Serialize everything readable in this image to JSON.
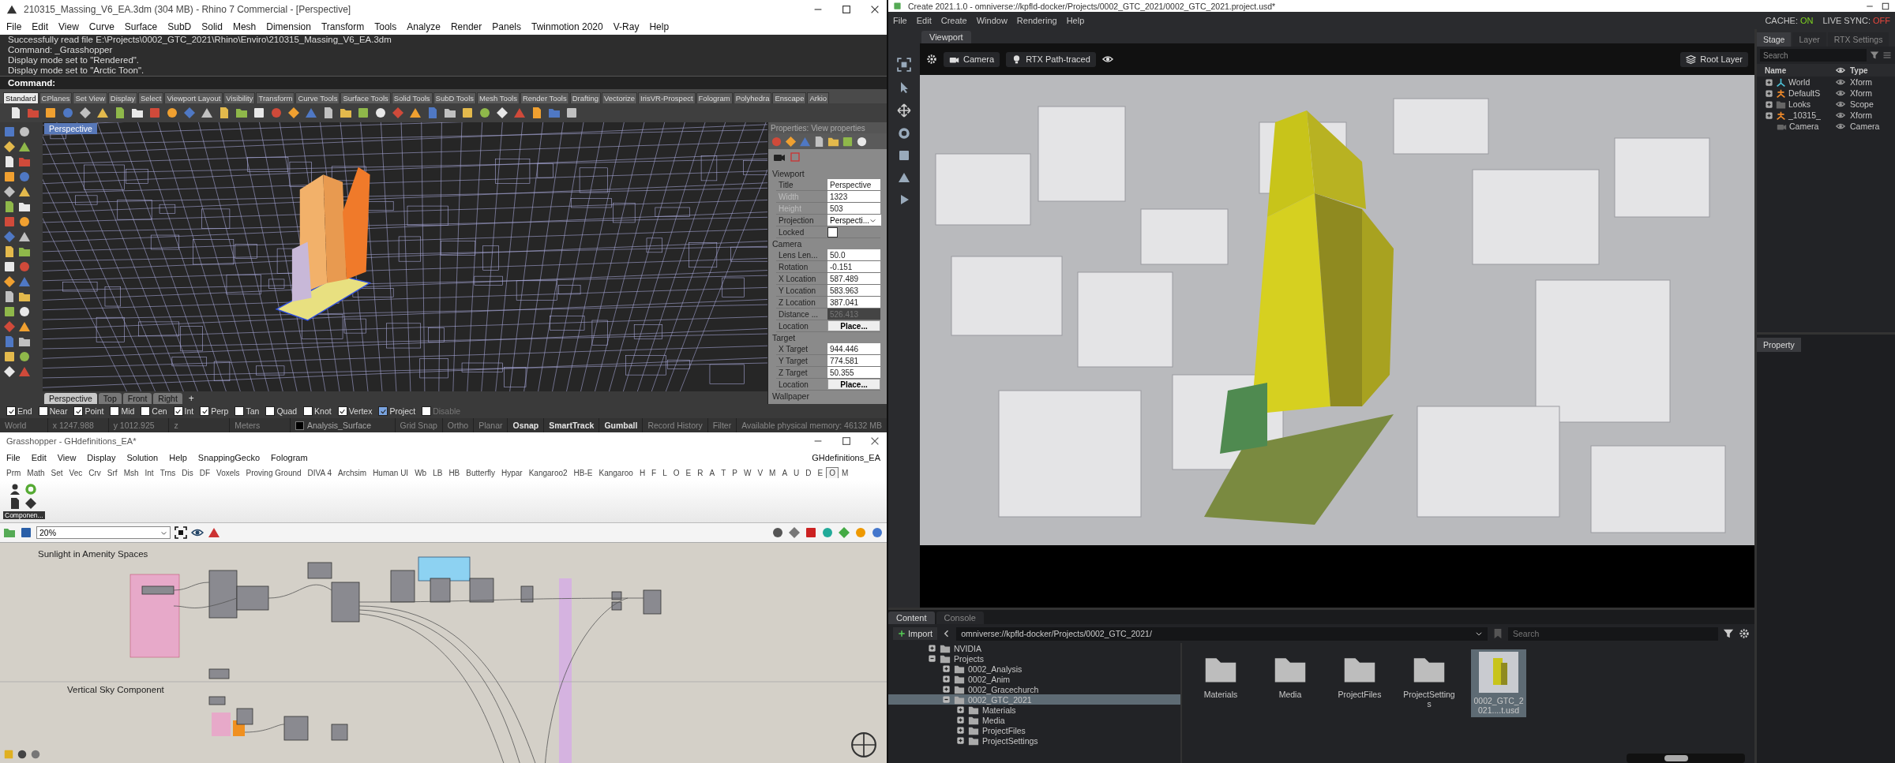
{
  "rhino": {
    "title": "210315_Massing_V6_EA.3dm (304 MB) - Rhino 7 Commercial - [Perspective]",
    "menu": [
      "File",
      "Edit",
      "View",
      "Curve",
      "Surface",
      "SubD",
      "Solid",
      "Mesh",
      "Dimension",
      "Transform",
      "Tools",
      "Analyze",
      "Render",
      "Panels",
      "Twinmotion 2020",
      "V-Ray",
      "Help"
    ],
    "command_history": [
      "Successfully read file  E:\\Projects\\0002_GTC_2021\\Rhino\\Enviro\\210315_Massing_V6_EA.3dm",
      "Command: _Grasshopper",
      "Display mode set to \"Rendered\".",
      "Display mode set to \"Arctic Toon\"."
    ],
    "command_prompt": "Command:",
    "toolbar_tabs": [
      {
        "label": "Standard",
        "selected": true
      },
      {
        "label": "CPlanes",
        "selected": false
      },
      {
        "label": "Set View",
        "selected": false
      },
      {
        "label": "Display",
        "selected": false
      },
      {
        "label": "Select",
        "selected": false
      },
      {
        "label": "Viewport Layout",
        "selected": false
      },
      {
        "label": "Visibility",
        "selected": false
      },
      {
        "label": "Transform",
        "selected": false
      },
      {
        "label": "Curve Tools",
        "selected": false
      },
      {
        "label": "Surface Tools",
        "selected": false
      },
      {
        "label": "Solid Tools",
        "selected": false
      },
      {
        "label": "SubD Tools",
        "selected": false
      },
      {
        "label": "Mesh Tools",
        "selected": false
      },
      {
        "label": "Render Tools",
        "selected": false
      },
      {
        "label": "Drafting",
        "selected": false
      },
      {
        "label": "Vectorize",
        "selected": false
      },
      {
        "label": "IrisVR-Prospect",
        "selected": false
      },
      {
        "label": "Fologram",
        "selected": false
      },
      {
        "label": "Polyhedra",
        "selected": false
      },
      {
        "label": "Enscape",
        "selected": false
      },
      {
        "label": "Arkio",
        "selected": false
      }
    ],
    "viewport": {
      "label": "Perspective"
    },
    "viewport_tabs": [
      {
        "label": "Perspective",
        "selected": true
      },
      {
        "label": "Top",
        "selected": false
      },
      {
        "label": "Front",
        "selected": false
      },
      {
        "label": "Right",
        "selected": false
      }
    ],
    "viewport_add": "+",
    "properties": {
      "title": "Properties: View properties",
      "sections": [
        {
          "heading": "Viewport",
          "rows": [
            {
              "kind": "text",
              "label": "Title",
              "value": "Perspective",
              "disabled": false,
              "read_only": false
            },
            {
              "kind": "text",
              "label": "Width",
              "value": "1323",
              "disabled": true,
              "read_only": false
            },
            {
              "kind": "text",
              "label": "Height",
              "value": "503",
              "disabled": true,
              "read_only": false
            },
            {
              "kind": "dropdown",
              "label": "Projection",
              "value": "Perspecti..."
            },
            {
              "kind": "checkbox",
              "label": "Locked",
              "checked": false
            }
          ]
        },
        {
          "heading": "Camera",
          "rows": [
            {
              "kind": "text",
              "label": "Lens Len...",
              "value": "50.0",
              "disabled": false,
              "read_only": false
            },
            {
              "kind": "text",
              "label": "Rotation",
              "value": "-0.151",
              "disabled": false,
              "read_only": false
            },
            {
              "kind": "text",
              "label": "X Location",
              "value": "587.489",
              "disabled": false,
              "read_only": false
            },
            {
              "kind": "text",
              "label": "Y Location",
              "value": "583.963",
              "disabled": false,
              "read_only": false
            },
            {
              "kind": "text",
              "label": "Z Location",
              "value": "387.041",
              "disabled": false,
              "read_only": false
            },
            {
              "kind": "text",
              "label": "Distance ...",
              "value": "526.413",
              "disabled": false,
              "read_only": true
            },
            {
              "kind": "button",
              "label": "Location",
              "value": "Place..."
            }
          ]
        },
        {
          "heading": "Target",
          "rows": [
            {
              "kind": "text",
              "label": "X Target",
              "value": "944.446",
              "disabled": false,
              "read_only": false
            },
            {
              "kind": "text",
              "label": "Y Target",
              "value": "774.581",
              "disabled": false,
              "read_only": false
            },
            {
              "kind": "text",
              "label": "Z Target",
              "value": "50.355",
              "disabled": false,
              "read_only": false
            },
            {
              "kind": "button",
              "label": "Location",
              "value": "Place..."
            }
          ]
        },
        {
          "heading": "Wallpaper"
        }
      ]
    },
    "osnaps": [
      {
        "label": "End",
        "checked": true,
        "disabled": false
      },
      {
        "label": "Near",
        "checked": false,
        "disabled": false
      },
      {
        "label": "Point",
        "checked": true,
        "disabled": false
      },
      {
        "label": "Mid",
        "checked": false,
        "disabled": false
      },
      {
        "label": "Cen",
        "checked": false,
        "disabled": false
      },
      {
        "label": "Int",
        "checked": true,
        "disabled": false
      },
      {
        "label": "Perp",
        "checked": true,
        "disabled": false
      },
      {
        "label": "Tan",
        "checked": false,
        "disabled": false
      },
      {
        "label": "Quad",
        "checked": false,
        "disabled": false
      },
      {
        "label": "Knot",
        "checked": false,
        "disabled": false
      },
      {
        "label": "Vertex",
        "checked": true,
        "disabled": false
      },
      {
        "label": "Project",
        "checked": true,
        "disabled": false
      },
      {
        "label": "Disable",
        "checked": false,
        "disabled": true
      }
    ],
    "status_bar": [
      {
        "kind": "pane",
        "label": "World"
      },
      {
        "kind": "pane",
        "label": "x 1247.988"
      },
      {
        "kind": "pane",
        "label": "y 1012.925"
      },
      {
        "kind": "pane",
        "label": "z"
      },
      {
        "kind": "pane",
        "label": "Meters"
      },
      {
        "kind": "layer",
        "label": "Analysis_Surface"
      },
      {
        "kind": "toggle",
        "label": "Grid Snap",
        "on": false
      },
      {
        "kind": "toggle",
        "label": "Ortho",
        "on": false
      },
      {
        "kind": "toggle",
        "label": "Planar",
        "on": false
      },
      {
        "kind": "toggle",
        "label": "Osnap",
        "on": true
      },
      {
        "kind": "toggle",
        "label": "SmartTrack",
        "on": true
      },
      {
        "kind": "toggle",
        "label": "Gumball",
        "on": true
      },
      {
        "kind": "toggle",
        "label": "Record History",
        "on": false
      },
      {
        "kind": "toggle",
        "label": "Filter",
        "on": false
      },
      {
        "kind": "message",
        "label": "Available physical memory: 46132 MB"
      }
    ]
  },
  "grasshopper": {
    "title": "Grasshopper - GHdefinitions_EA*",
    "menu": [
      "File",
      "Edit",
      "View",
      "Display",
      "Solution",
      "Help",
      "SnappingGecko",
      "Fologram"
    ],
    "document_name": "GHdefinitions_EA",
    "tabs": [
      {
        "label": "Prm",
        "selected": false
      },
      {
        "label": "Math",
        "selected": false
      },
      {
        "label": "Set",
        "selected": false
      },
      {
        "label": "Vec",
        "selected": false
      },
      {
        "label": "Crv",
        "selected": false
      },
      {
        "label": "Srf",
        "selected": false
      },
      {
        "label": "Msh",
        "selected": false
      },
      {
        "label": "Int",
        "selected": false
      },
      {
        "label": "Trns",
        "selected": false
      },
      {
        "label": "Dis",
        "selected": false
      },
      {
        "label": "DF",
        "selected": false
      },
      {
        "label": "Voxels",
        "selected": false
      },
      {
        "label": "Proving Ground",
        "selected": false
      },
      {
        "label": "DIVA 4",
        "selected": false
      },
      {
        "label": "Archsim",
        "selected": false
      },
      {
        "label": "Human UI",
        "selected": false
      },
      {
        "label": "Wb",
        "selected": false
      },
      {
        "label": "LB",
        "selected": false
      },
      {
        "label": "HB",
        "selected": false
      },
      {
        "label": "Butterfly",
        "selected": false
      },
      {
        "label": "Hypar",
        "selected": false
      },
      {
        "label": "Kangaroo2",
        "selected": false
      },
      {
        "label": "HB-E",
        "selected": false
      },
      {
        "label": "Kangaroo",
        "selected": false
      },
      {
        "label": "H",
        "selected": false
      },
      {
        "label": "F",
        "selected": false
      },
      {
        "label": "L",
        "selected": false
      },
      {
        "label": "O",
        "selected": false
      },
      {
        "label": "E",
        "selected": false
      },
      {
        "label": "R",
        "selected": false
      },
      {
        "label": "A",
        "selected": false
      },
      {
        "label": "T",
        "selected": false
      },
      {
        "label": "P",
        "selected": false
      },
      {
        "label": "W",
        "selected": false
      },
      {
        "label": "V",
        "selected": false
      },
      {
        "label": "M",
        "selected": false
      },
      {
        "label": "A",
        "selected": false
      },
      {
        "label": "U",
        "selected": false
      },
      {
        "label": "D",
        "selected": false
      },
      {
        "label": "E",
        "selected": false
      },
      {
        "label": "O",
        "selected": true
      },
      {
        "label": "M",
        "selected": false
      }
    ],
    "ribbon_group": "Componen...",
    "zoom": "20%",
    "canvas_groups": [
      {
        "label": "Sunlight in Amenity Spaces"
      },
      {
        "label": "Vertical Sky Component"
      }
    ]
  },
  "omniverse": {
    "title": "Create 2021.1.0 - omniverse://kpfld-docker/Projects/0002_GTC_2021/0002_GTC_2021.project.usd*",
    "menu": [
      "File",
      "Edit",
      "Create",
      "Window",
      "Rendering",
      "Help"
    ],
    "sync_status": [
      {
        "label": "CACHE:",
        "value": "ON",
        "on": true
      },
      {
        "label": "LIVE SYNC:",
        "value": "OFF",
        "on": false
      }
    ],
    "viewport_tab": "Viewport",
    "viewport_buttons": [
      {
        "kind": "camera",
        "label": "Camera"
      },
      {
        "kind": "light",
        "label": "RTX Path-traced"
      }
    ],
    "root_layer": "Root Layer",
    "stage": {
      "tabs": [
        {
          "label": "Stage",
          "selected": true
        },
        {
          "label": "Layer",
          "selected": false
        },
        {
          "label": "RTX Settings",
          "selected": false
        }
      ],
      "search_placeholder": "Search",
      "columns": [
        "Name",
        "Type"
      ],
      "rows": [
        {
          "name": "World",
          "type": "Xform",
          "kind": "world",
          "expandable": true
        },
        {
          "name": "DefaultS",
          "type": "Xform",
          "kind": "xform",
          "expandable": true
        },
        {
          "name": "Looks",
          "type": "Scope",
          "kind": "scope",
          "expandable": true
        },
        {
          "name": "_10315_",
          "type": "Xform",
          "kind": "xform",
          "expandable": true
        },
        {
          "name": "Camera",
          "type": "Camera",
          "kind": "camera",
          "expandable": false
        }
      ]
    },
    "property_tab": "Property",
    "content": {
      "tabs": [
        {
          "label": "Content",
          "selected": true
        },
        {
          "label": "Console",
          "selected": false
        }
      ],
      "import": "Import",
      "path": "omniverse://kpfld-docker/Projects/0002_GTC_2021/",
      "search_placeholder": "Search",
      "thumbnail_size": {
        "level": 0.4
      },
      "tree": [
        {
          "label": "NVIDIA",
          "expanded": false,
          "selected": false
        },
        {
          "label": "Projects",
          "expanded": true,
          "selected": false,
          "children": [
            {
              "label": "0002_Analysis",
              "expanded": false,
              "selected": false
            },
            {
              "label": "0002_Anim",
              "expanded": false,
              "selected": false
            },
            {
              "label": "0002_Gracechurch",
              "expanded": false,
              "selected": false
            },
            {
              "label": "0002_GTC_2021",
              "expanded": true,
              "selected": true,
              "children": [
                {
                  "label": "Materials",
                  "expanded": false,
                  "selected": false
                },
                {
                  "label": "Media",
                  "expanded": false,
                  "selected": false
                },
                {
                  "label": "ProjectFiles",
                  "expanded": false,
                  "selected": false
                },
                {
                  "label": "ProjectSettings",
                  "expanded": false,
                  "selected": false
                }
              ]
            }
          ]
        }
      ],
      "items": [
        {
          "kind": "folder",
          "label": "Materials",
          "selected": false
        },
        {
          "kind": "folder",
          "label": "Media",
          "selected": false
        },
        {
          "kind": "folder",
          "label": "ProjectFiles",
          "selected": false
        },
        {
          "kind": "folder",
          "label": "ProjectSettings",
          "selected": false
        },
        {
          "kind": "usd",
          "label": "0002_GTC_2021....t.usd",
          "selected": true
        }
      ]
    }
  }
}
